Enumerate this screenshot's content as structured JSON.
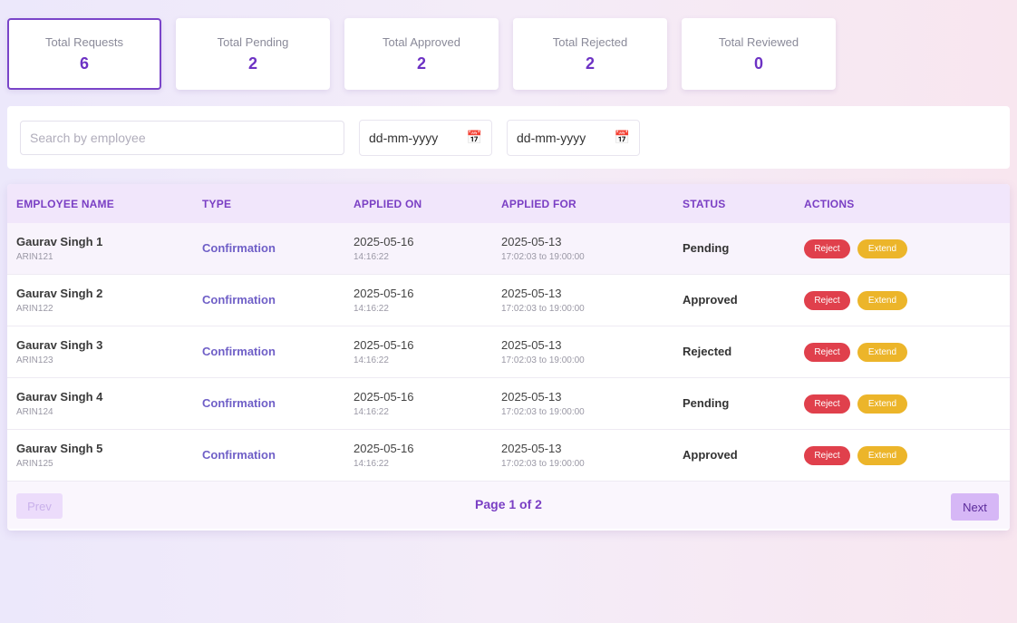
{
  "stats": [
    {
      "label": "Total Requests",
      "value": "6"
    },
    {
      "label": "Total Pending",
      "value": "2"
    },
    {
      "label": "Total Approved",
      "value": "2"
    },
    {
      "label": "Total Rejected",
      "value": "2"
    },
    {
      "label": "Total Reviewed",
      "value": "0"
    }
  ],
  "filters": {
    "search_placeholder": "Search by employee",
    "date_from": "dd-mm-yyyy",
    "date_to": "dd-mm-yyyy"
  },
  "table": {
    "headers": [
      "EMPLOYEE NAME",
      "TYPE",
      "APPLIED ON",
      "APPLIED FOR",
      "STATUS",
      "ACTIONS"
    ],
    "rows": [
      {
        "name": "Gaurav Singh 1",
        "id": "ARIN121",
        "type": "Confirmation",
        "applied_on_date": "2025-05-16",
        "applied_on_time": "14:16:22",
        "applied_for_date": "2025-05-13",
        "applied_for_time": "17:02:03 to 19:00:00",
        "status": "Pending"
      },
      {
        "name": "Gaurav Singh 2",
        "id": "ARIN122",
        "type": "Confirmation",
        "applied_on_date": "2025-05-16",
        "applied_on_time": "14:16:22",
        "applied_for_date": "2025-05-13",
        "applied_for_time": "17:02:03 to 19:00:00",
        "status": "Approved"
      },
      {
        "name": "Gaurav Singh 3",
        "id": "ARIN123",
        "type": "Confirmation",
        "applied_on_date": "2025-05-16",
        "applied_on_time": "14:16:22",
        "applied_for_date": "2025-05-13",
        "applied_for_time": "17:02:03 to 19:00:00",
        "status": "Rejected"
      },
      {
        "name": "Gaurav Singh 4",
        "id": "ARIN124",
        "type": "Confirmation",
        "applied_on_date": "2025-05-16",
        "applied_on_time": "14:16:22",
        "applied_for_date": "2025-05-13",
        "applied_for_time": "17:02:03 to 19:00:00",
        "status": "Pending"
      },
      {
        "name": "Gaurav Singh 5",
        "id": "ARIN125",
        "type": "Confirmation",
        "applied_on_date": "2025-05-16",
        "applied_on_time": "14:16:22",
        "applied_for_date": "2025-05-13",
        "applied_for_time": "17:02:03 to 19:00:00",
        "status": "Approved"
      }
    ],
    "actions": {
      "reject_label": "Reject",
      "extend_label": "Extend"
    }
  },
  "pagination": {
    "prev_label": "Prev",
    "page_info": "Page 1 of 2",
    "next_label": "Next"
  },
  "icons": {
    "calendar": "calendar-icon"
  },
  "colors": {
    "accent": "#6d32c4",
    "reject": "#e0404c",
    "extend": "#ecb52a",
    "header_bg": "#f1e6fb"
  }
}
